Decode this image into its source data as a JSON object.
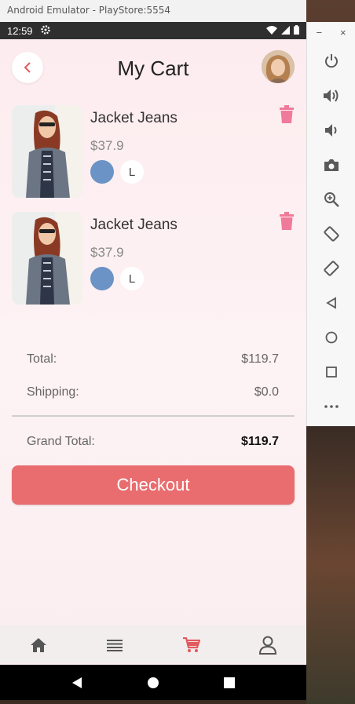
{
  "window": {
    "title": "Android Emulator - PlayStore:5554"
  },
  "status_bar": {
    "time": "12:59"
  },
  "header": {
    "title": "My Cart"
  },
  "items": [
    {
      "name": "Jacket Jeans",
      "price": "$37.9",
      "color": "#6b93c6",
      "size": "L"
    },
    {
      "name": "Jacket Jeans",
      "price": "$37.9",
      "color": "#6b93c6",
      "size": "L"
    }
  ],
  "summary": {
    "total_label": "Total:",
    "total_value": "$119.7",
    "shipping_label": "Shipping:",
    "shipping_value": "$0.0",
    "grand_label": "Grand Total:",
    "grand_value": "$119.7"
  },
  "checkout_label": "Checkout",
  "nav": [
    "home-icon",
    "list-icon",
    "cart-icon",
    "profile-icon"
  ],
  "colors": {
    "accent": "#e96d6f",
    "trash": "#f07a9a",
    "active_nav": "#e05a5e"
  }
}
